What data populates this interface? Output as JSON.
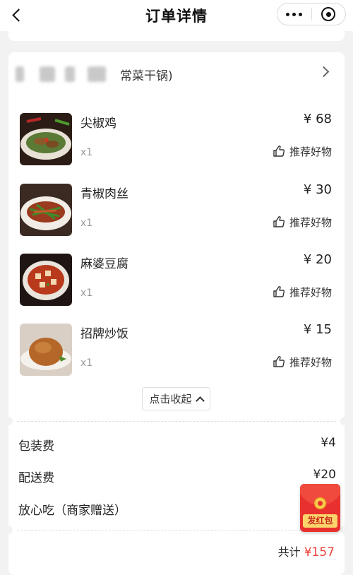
{
  "header": {
    "title": "订单详情"
  },
  "shop": {
    "name_suffix": "常菜干锅)"
  },
  "items": [
    {
      "name": "尖椒鸡",
      "price": "¥ 68",
      "qty": "x1",
      "action": "推荐好物"
    },
    {
      "name": "青椒肉丝",
      "price": "¥ 30",
      "qty": "x1",
      "action": "推荐好物"
    },
    {
      "name": "麻婆豆腐",
      "price": "¥ 20",
      "qty": "x1",
      "action": "推荐好物"
    },
    {
      "name": "招牌炒饭",
      "price": "¥ 15",
      "qty": "x1",
      "action": "推荐好物"
    }
  ],
  "collapse_label": "点击收起",
  "fees": [
    {
      "label": "包装费",
      "value": "¥4"
    },
    {
      "label": "配送费",
      "value": "¥20"
    },
    {
      "label": "放心吃（商家赠送）",
      "value": ""
    }
  ],
  "total": {
    "label": "共计",
    "amount": "¥157"
  },
  "red_packet": {
    "label": "发红包"
  },
  "colors": {
    "accent_red": "#e8413a",
    "background": "#f2f2f2"
  }
}
